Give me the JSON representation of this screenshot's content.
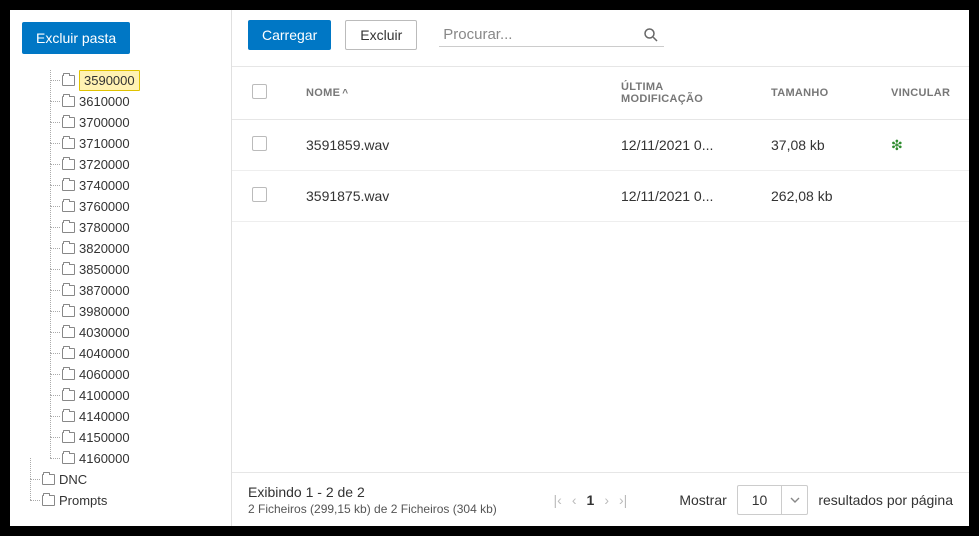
{
  "sidebar": {
    "delete_folder_label": "Excluir pasta",
    "folders": [
      {
        "label": "3590000",
        "selected": true
      },
      {
        "label": "3610000"
      },
      {
        "label": "3700000"
      },
      {
        "label": "3710000"
      },
      {
        "label": "3720000"
      },
      {
        "label": "3740000"
      },
      {
        "label": "3760000"
      },
      {
        "label": "3780000"
      },
      {
        "label": "3820000"
      },
      {
        "label": "3850000"
      },
      {
        "label": "3870000"
      },
      {
        "label": "3980000"
      },
      {
        "label": "4030000"
      },
      {
        "label": "4040000"
      },
      {
        "label": "4060000"
      },
      {
        "label": "4100000"
      },
      {
        "label": "4140000"
      },
      {
        "label": "4150000"
      },
      {
        "label": "4160000"
      }
    ],
    "root_folders": [
      {
        "label": "DNC"
      },
      {
        "label": "Prompts"
      }
    ]
  },
  "toolbar": {
    "load_label": "Carregar",
    "delete_label": "Excluir",
    "search_placeholder": "Procurar..."
  },
  "table": {
    "headers": {
      "name": "Nome",
      "sort_indicator": "^",
      "modified": "Última modificação",
      "size": "Tamanho",
      "link": "Vincular"
    },
    "rows": [
      {
        "name": "3591859.wav",
        "modified": "12/11/2021 0...",
        "size": "37,08 kb",
        "linked": true
      },
      {
        "name": "3591875.wav",
        "modified": "12/11/2021 0...",
        "size": "262,08 kb",
        "linked": false
      }
    ]
  },
  "footer": {
    "showing_text": "Exibindo 1 - 2 de 2",
    "summary_text": "2 Ficheiros (299,15 kb) de 2 Ficheiros (304 kb)",
    "current_page": "1",
    "show_label": "Mostrar",
    "page_size": "10",
    "per_page_label": "resultados por página"
  }
}
